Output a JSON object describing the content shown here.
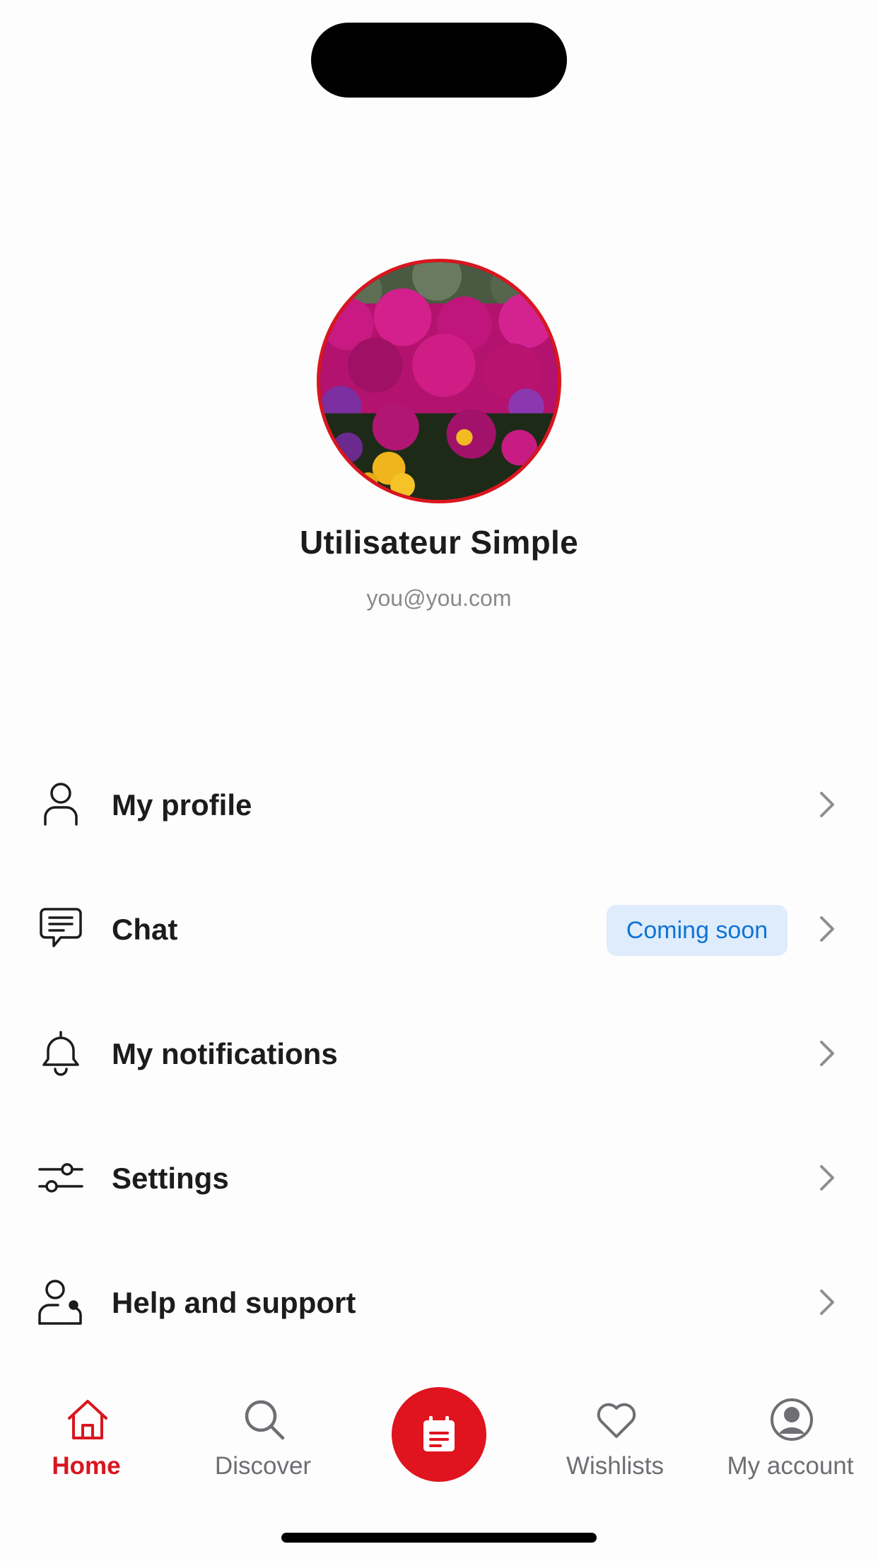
{
  "profile": {
    "name": "Utilisateur Simple",
    "email": "you@you.com"
  },
  "menu": {
    "items": [
      {
        "label": "My profile",
        "icon": "person-icon"
      },
      {
        "label": "Chat",
        "icon": "chat-icon",
        "badge": "Coming soon"
      },
      {
        "label": "My notifications",
        "icon": "bell-icon"
      },
      {
        "label": "Settings",
        "icon": "sliders-icon"
      },
      {
        "label": "Help and support",
        "icon": "support-person-icon"
      }
    ]
  },
  "tabbar": {
    "tabs": [
      {
        "label": "Home",
        "icon": "home-icon",
        "active": true
      },
      {
        "label": "Discover",
        "icon": "search-icon",
        "active": false
      },
      {
        "label": "",
        "icon": "calendar-icon",
        "active": false
      },
      {
        "label": "Wishlists",
        "icon": "heart-icon",
        "active": false
      },
      {
        "label": "My account",
        "icon": "account-icon",
        "active": false
      }
    ]
  },
  "colors": {
    "accent": "#e0141e",
    "badge_bg": "#deecfb",
    "badge_text": "#0f73d6",
    "muted": "#8a8a8e"
  }
}
